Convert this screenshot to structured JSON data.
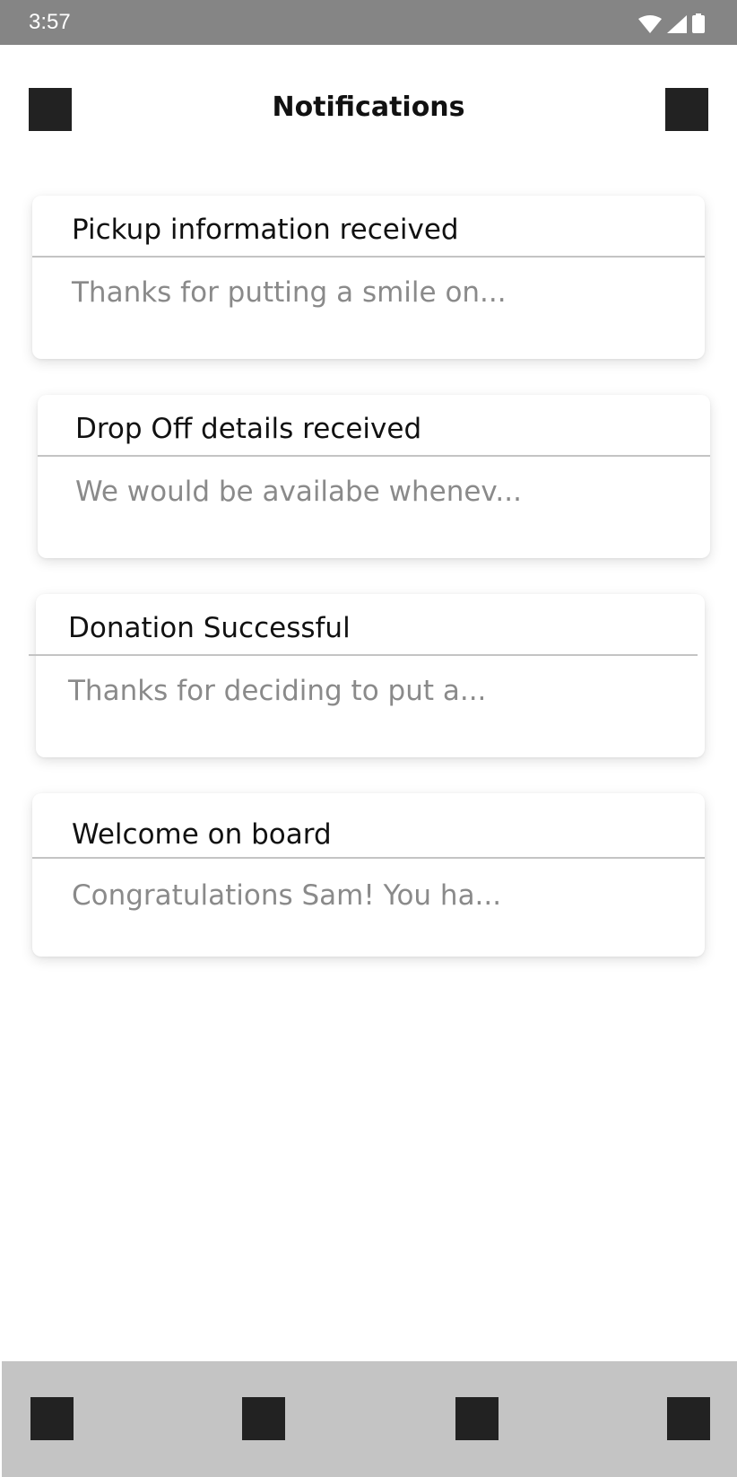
{
  "status_bar": {
    "time": "3:57",
    "icons": [
      "wifi-icon",
      "cellular-signal-icon",
      "battery-icon"
    ]
  },
  "header": {
    "title": "Notifications",
    "left_icon": "menu-icon",
    "right_icon": "action-icon"
  },
  "notifications": [
    {
      "title": "Pickup information received",
      "preview": "Thanks for putting a smile on..."
    },
    {
      "title": "Drop Off details received",
      "preview": "We would be availabe whenev..."
    },
    {
      "title": "Donation Successful",
      "preview": "Thanks for deciding to put a..."
    },
    {
      "title": "Welcome on board",
      "preview": "Congratulations Sam! You ha..."
    }
  ],
  "bottom_nav": {
    "items": [
      "nav-icon-1",
      "nav-icon-2",
      "nav-icon-3",
      "nav-icon-4"
    ]
  },
  "colors": {
    "status_bar": "#858585",
    "icon_placeholder": "#222222",
    "bottom_nav": "#c4c4c4",
    "preview_text": "#8a8a8a"
  }
}
